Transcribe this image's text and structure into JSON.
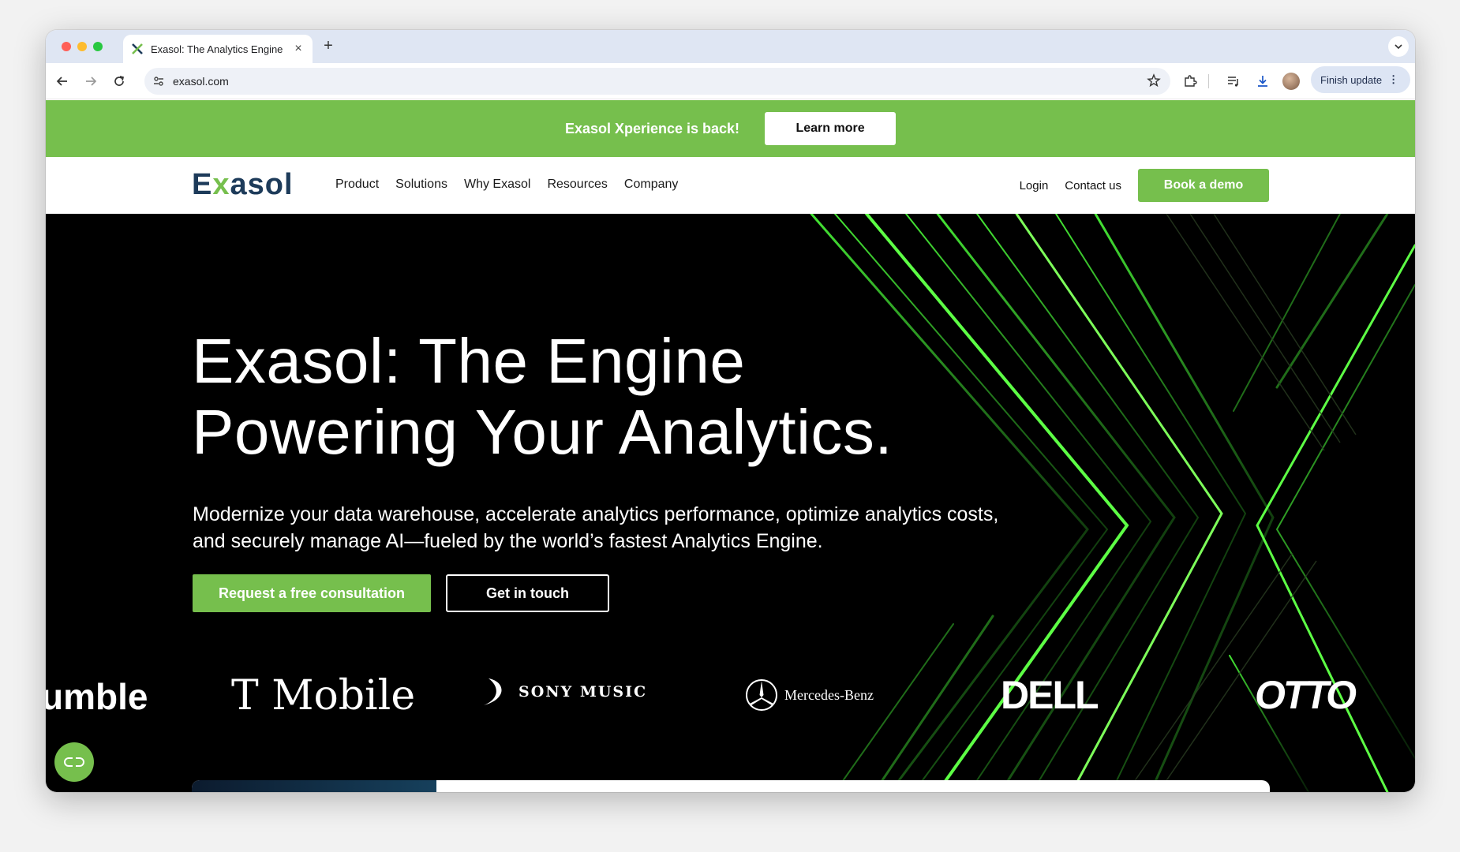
{
  "browser": {
    "tab_title": "Exasol: The Analytics Engine",
    "url": "exasol.com",
    "finish_update_label": "Finish update"
  },
  "banner": {
    "text": "Exasol Xperience is back!",
    "button": "Learn more"
  },
  "nav": {
    "logo": "Exasol",
    "menu": [
      "Product",
      "Solutions",
      "Why Exasol",
      "Resources",
      "Company"
    ],
    "login": "Login",
    "contact": "Contact us",
    "demo": "Book a demo"
  },
  "hero": {
    "title_line1": "Exasol: The Engine",
    "title_line2": "Powering Your Analytics.",
    "subtitle": "Modernize your data warehouse, accelerate analytics performance, optimize analytics costs, and securely manage AI—fueled by the world’s fastest Analytics Engine.",
    "cta_primary": "Request a free consultation",
    "cta_secondary": "Get in touch"
  },
  "clients": {
    "bumble": "umble",
    "tmobile": "T Mobile",
    "sony": "SONY MUSIC",
    "mercedes": "Mercedes-Benz",
    "dell": "DELL",
    "otto": "OTTO"
  },
  "colors": {
    "brand_green": "#76bf4d",
    "logo_navy": "#1d3b5a",
    "hero_bg": "#000000"
  }
}
